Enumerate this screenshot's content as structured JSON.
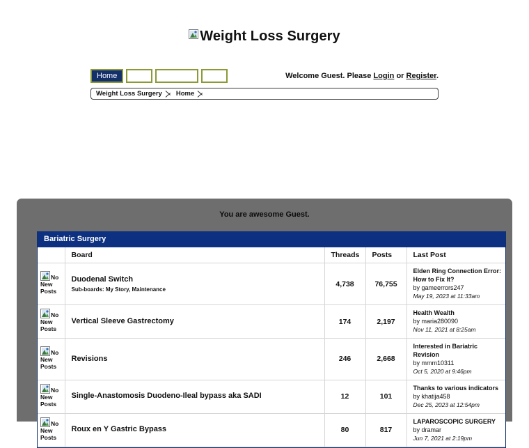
{
  "header": {
    "logo_alt": "Weight Loss Surgery",
    "logo_icon": "broken-image-icon"
  },
  "nav": {
    "tabs": [
      {
        "label": "Home",
        "active": true
      },
      {
        "label": "",
        "active": false
      },
      {
        "label": "",
        "active": false
      },
      {
        "label": "",
        "active": false
      }
    ],
    "welcome": {
      "prefix": "Welcome Guest. Please ",
      "login_label": "Login",
      "separator": " or ",
      "register_label": "Register",
      "suffix": "."
    }
  },
  "breadcrumb": {
    "items": [
      "Weight Loss Surgery",
      "Home"
    ]
  },
  "main": {
    "greeting": "You are awesome Guest.",
    "category_title": "Bariatric Surgery",
    "columns": {
      "board": "Board",
      "threads": "Threads",
      "posts": "Posts",
      "last_post": "Last Post"
    },
    "status_icon_alt": "No New Posts",
    "status_icon": "broken-image-icon",
    "subboards_prefix": "Sub-boards: ",
    "rows": [
      {
        "name": "Duodenal Switch",
        "subboards": "My Story, Maintenance",
        "threads": "4,738",
        "posts": "76,755",
        "last_post_title": "Elden Ring Connection Error: How to Fix It?",
        "last_post_by": "by gameerrors247",
        "last_post_date": "May 19, 2023 at 11:33am"
      },
      {
        "name": "Vertical Sleeve Gastrectomy",
        "subboards": "",
        "threads": "174",
        "posts": "2,197",
        "last_post_title": "Health Wealth",
        "last_post_by": "by maria280090",
        "last_post_date": "Nov 11, 2021 at 8:25am"
      },
      {
        "name": "Revisions",
        "subboards": "",
        "threads": "246",
        "posts": "2,668",
        "last_post_title": "Interested in Bariatric Revision",
        "last_post_by": "by mmm10311",
        "last_post_date": "Oct 5, 2020 at 9:46pm"
      },
      {
        "name": "Single-Anastomosis Duodeno-Ileal bypass aka SADI",
        "subboards": "",
        "threads": "12",
        "posts": "101",
        "last_post_title": "Thanks to various indicators",
        "last_post_by": "by khatija458",
        "last_post_date": "Dec 25, 2023 at 12:54pm"
      },
      {
        "name": "Roux en Y Gastric Bypass",
        "subboards": "",
        "threads": "80",
        "posts": "817",
        "last_post_title": "LAPAROSCOPIC SURGERY",
        "last_post_by": "by dramar",
        "last_post_date": "Jun 7, 2021 at 2:19pm"
      }
    ]
  },
  "colors": {
    "category_bar": "#0d3180",
    "active_tab": "#14306b",
    "tab_border": "#8a9a36",
    "panel_grey": "#6e6e6e"
  }
}
